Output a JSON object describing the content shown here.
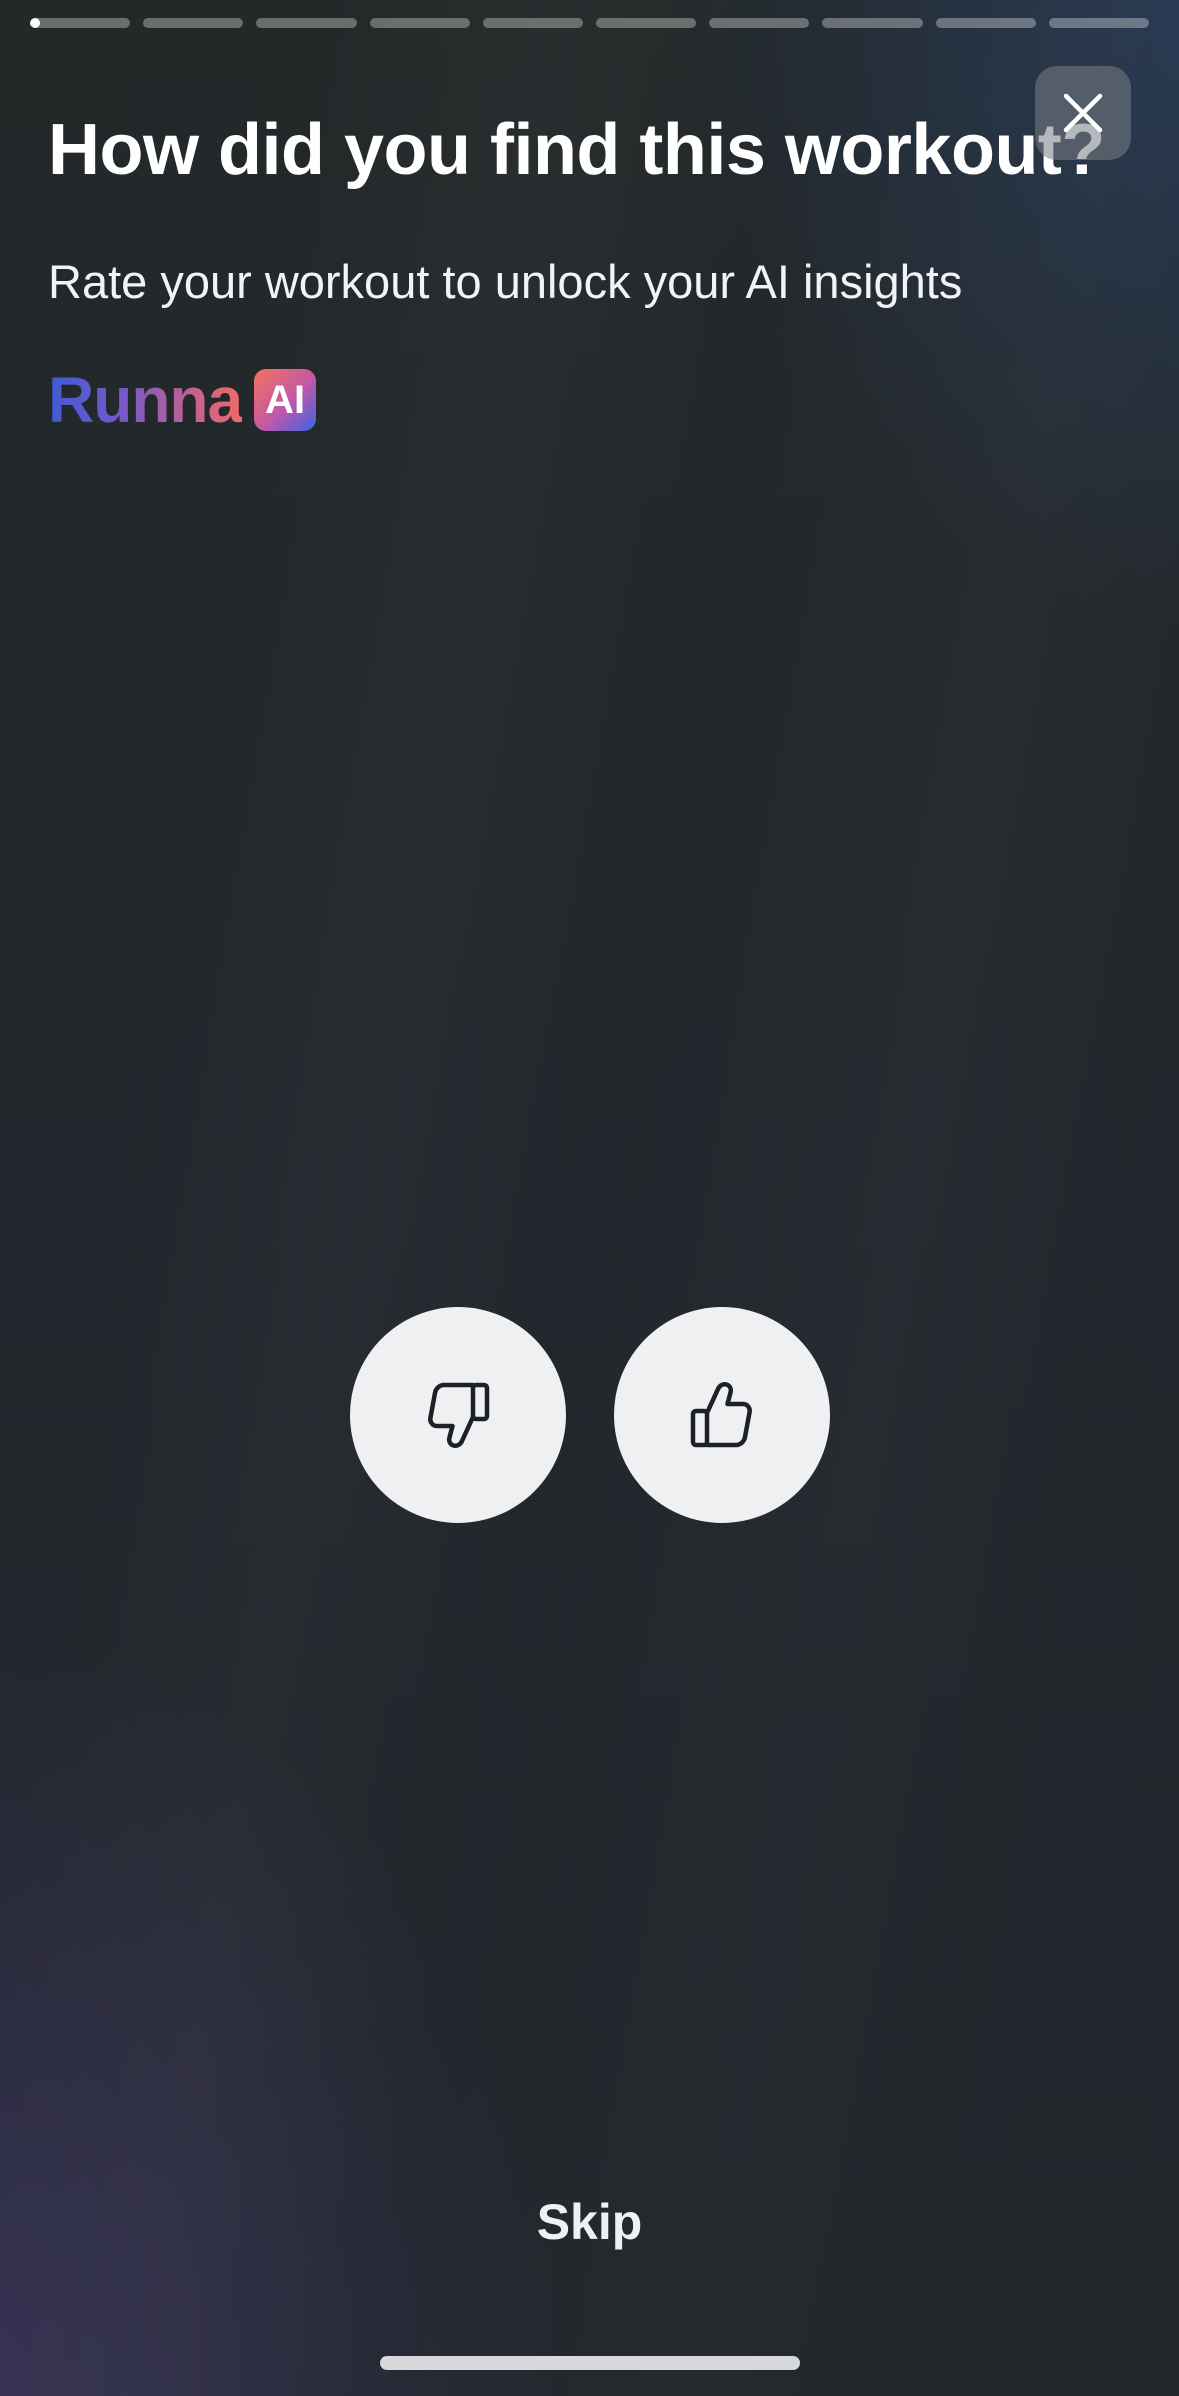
{
  "progress": {
    "segments": 10,
    "current_segment": 1,
    "current_fill_fraction": 0.1
  },
  "close": {
    "icon": "close-icon"
  },
  "header": {
    "title": "How did you find this workout?",
    "subtitle": "Rate your workout to unlock your AI insights"
  },
  "brand": {
    "wordmark": "Runna",
    "badge": "AI"
  },
  "rating": {
    "thumbs_down_icon": "thumbs-down-icon",
    "thumbs_up_icon": "thumbs-up-icon"
  },
  "footer": {
    "skip_label": "Skip"
  },
  "colors": {
    "button_bg": "#eef0f2",
    "brand_start": "#3f5bd6",
    "brand_end": "#ee6a6a"
  }
}
